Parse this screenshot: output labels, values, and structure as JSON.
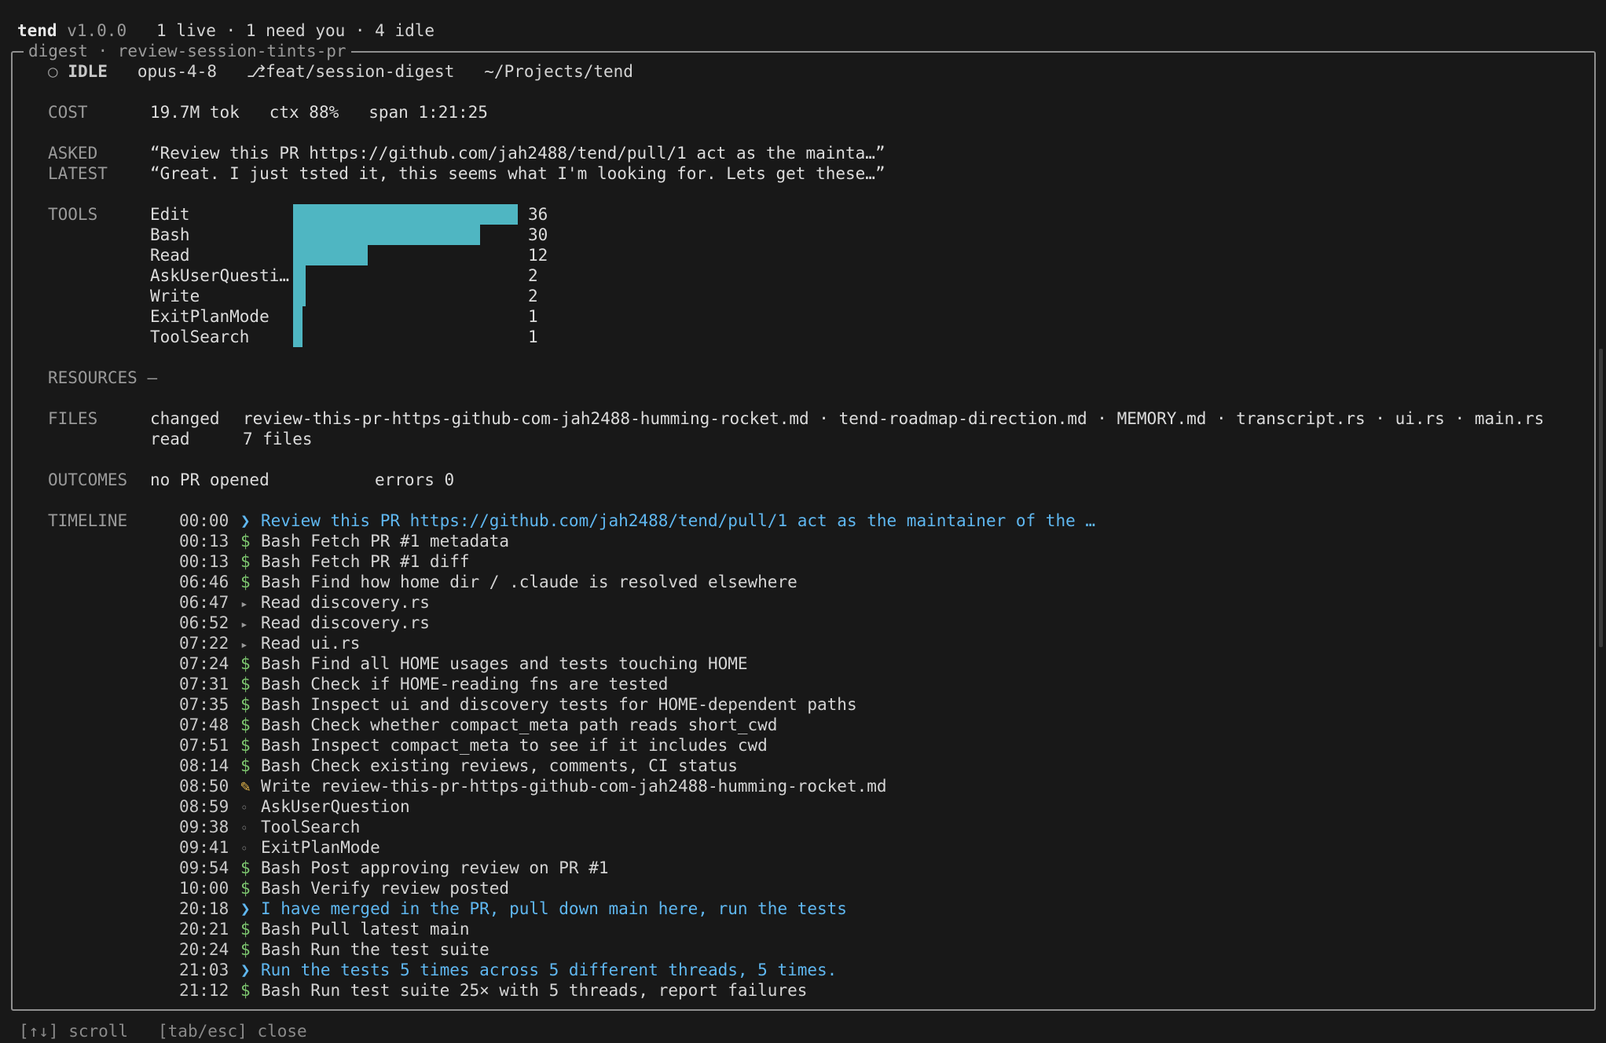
{
  "header": {
    "app_name": "tend",
    "version": "v1.0.0",
    "status_summary": "1 live · 1 need you · 4 idle"
  },
  "panel": {
    "title": "digest · review-session-tints-pr"
  },
  "session": {
    "state_icon": "○",
    "state": "IDLE",
    "model": "opus-4-8",
    "branch_icon": "⎇",
    "branch": "feat/session-digest",
    "path": "~/Projects/tend"
  },
  "cost": {
    "label": "COST",
    "tokens": "19.7M tok",
    "ctx": "ctx 88%",
    "span": "span 1:21:25"
  },
  "asked": {
    "label": "ASKED",
    "text": "“Review this PR https://github.com/jah2488/tend/pull/1 act as the mainta…”"
  },
  "latest": {
    "label": "LATEST",
    "text": "“Great. I just tsted it, this seems what I'm looking for. Lets get these…”"
  },
  "tools": {
    "label": "TOOLS",
    "items": [
      {
        "name": "Edit",
        "count": 36
      },
      {
        "name": "Bash",
        "count": 30
      },
      {
        "name": "Read",
        "count": 12
      },
      {
        "name": "AskUserQuesti…",
        "count": 2
      },
      {
        "name": "Write",
        "count": 2
      },
      {
        "name": "ExitPlanMode",
        "count": 1
      },
      {
        "name": "ToolSearch",
        "count": 1
      }
    ],
    "max": 36
  },
  "resources": {
    "label": "RESOURCES",
    "value": "—"
  },
  "files": {
    "label": "FILES",
    "changed_label": "changed",
    "changed": "review-this-pr-https-github-com-jah2488-humming-rocket.md · tend-roadmap-direction.md · MEMORY.md · transcript.rs · ui.rs · main.rs",
    "read_label": "read",
    "read": "7 files"
  },
  "outcomes": {
    "label": "OUTCOMES",
    "pr": "no PR opened",
    "errors": "errors 0"
  },
  "timeline": {
    "label": "TIMELINE",
    "entries": [
      {
        "time": "00:00",
        "icon": "❯",
        "kind": "prompt",
        "text": "Review this PR https://github.com/jah2488/tend/pull/1 act as the maintainer of the …"
      },
      {
        "time": "00:13",
        "icon": "$",
        "kind": "bash",
        "text": "Bash Fetch PR #1 metadata"
      },
      {
        "time": "00:13",
        "icon": "$",
        "kind": "bash",
        "text": "Bash Fetch PR #1 diff"
      },
      {
        "time": "06:46",
        "icon": "$",
        "kind": "bash",
        "text": "Bash Find how home dir / .claude is resolved elsewhere"
      },
      {
        "time": "06:47",
        "icon": "▸",
        "kind": "read",
        "text": "Read discovery.rs"
      },
      {
        "time": "06:52",
        "icon": "▸",
        "kind": "read",
        "text": "Read discovery.rs"
      },
      {
        "time": "07:22",
        "icon": "▸",
        "kind": "read",
        "text": "Read ui.rs"
      },
      {
        "time": "07:24",
        "icon": "$",
        "kind": "bash",
        "text": "Bash Find all HOME usages and tests touching HOME"
      },
      {
        "time": "07:31",
        "icon": "$",
        "kind": "bash",
        "text": "Bash Check if HOME-reading fns are tested"
      },
      {
        "time": "07:35",
        "icon": "$",
        "kind": "bash",
        "text": "Bash Inspect ui and discovery tests for HOME-dependent paths"
      },
      {
        "time": "07:48",
        "icon": "$",
        "kind": "bash",
        "text": "Bash Check whether compact_meta path reads short_cwd"
      },
      {
        "time": "07:51",
        "icon": "$",
        "kind": "bash",
        "text": "Bash Inspect compact_meta to see if it includes cwd"
      },
      {
        "time": "08:14",
        "icon": "$",
        "kind": "bash",
        "text": "Bash Check existing reviews, comments, CI status"
      },
      {
        "time": "08:50",
        "icon": "✎",
        "kind": "write",
        "text": "Write review-this-pr-https-github-com-jah2488-humming-rocket.md"
      },
      {
        "time": "08:59",
        "icon": "◦",
        "kind": "other",
        "text": "AskUserQuestion"
      },
      {
        "time": "09:38",
        "icon": "◦",
        "kind": "other",
        "text": "ToolSearch"
      },
      {
        "time": "09:41",
        "icon": "◦",
        "kind": "other",
        "text": "ExitPlanMode"
      },
      {
        "time": "09:54",
        "icon": "$",
        "kind": "bash",
        "text": "Bash Post approving review on PR #1"
      },
      {
        "time": "10:00",
        "icon": "$",
        "kind": "bash",
        "text": "Bash Verify review posted"
      },
      {
        "time": "20:18",
        "icon": "❯",
        "kind": "prompt",
        "text": "I have merged in the PR, pull down main here, run the tests"
      },
      {
        "time": "20:21",
        "icon": "$",
        "kind": "bash",
        "text": "Bash Pull latest main"
      },
      {
        "time": "20:24",
        "icon": "$",
        "kind": "bash",
        "text": "Bash Run the test suite"
      },
      {
        "time": "21:03",
        "icon": "❯",
        "kind": "prompt",
        "text": "Run the tests 5 times across 5 different threads, 5 times."
      },
      {
        "time": "21:12",
        "icon": "$",
        "kind": "bash",
        "text": "Bash Run test suite 25× with 5 threads, report failures"
      }
    ]
  },
  "footer": {
    "scroll_hint": "[↑↓] scroll",
    "close_hint": "[tab/esc] close"
  },
  "colors": {
    "background": "#181818",
    "bar": "#4fb6c2",
    "prompt": "#5fb7f0",
    "bash_icon": "#7dc66f",
    "border": "#8f8f8f"
  }
}
